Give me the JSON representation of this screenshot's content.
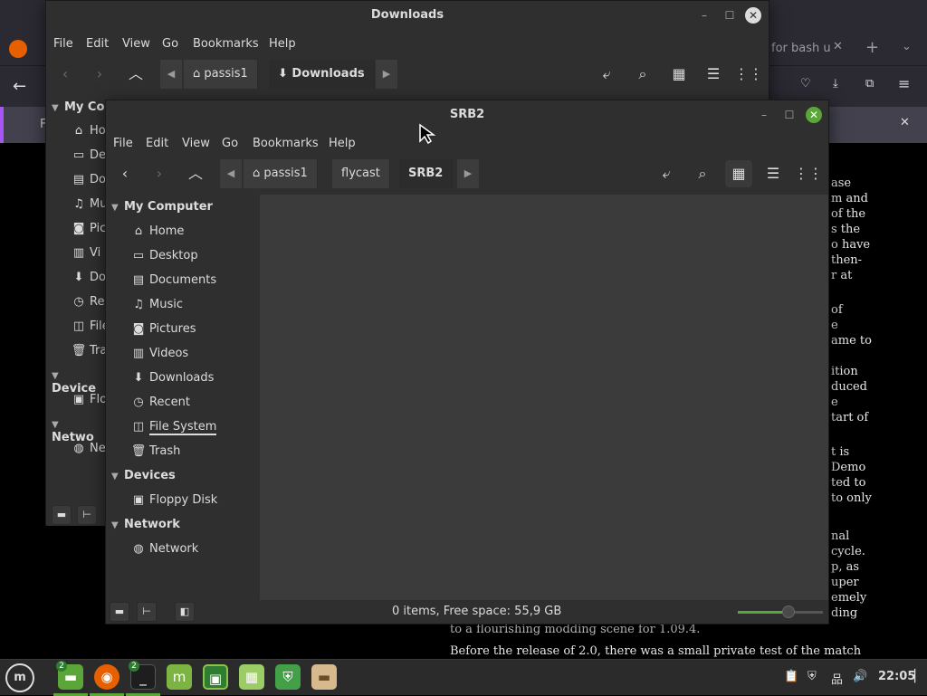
{
  "browser": {
    "tab_fragment": "for bash u",
    "notif_letter": "F",
    "article_right_fragments": [
      "ase",
      "m and",
      "of the",
      "s the",
      "o have",
      "then-",
      "r at",
      "of",
      "e",
      "ame to",
      "ition",
      "duced",
      "e",
      "tart of",
      "t is",
      "Demo",
      "ted to",
      "to only",
      "nal",
      "cycle.",
      "p, as",
      "uper",
      "emely",
      "ding"
    ],
    "article_lines": [
      "to a flourishing modding scene for 1.09.4.",
      "Before the release of 2.0, there was a small private test of the match"
    ]
  },
  "back_window": {
    "title": "Downloads",
    "menu": [
      "File",
      "Edit",
      "View",
      "Go",
      "Bookmarks",
      "Help"
    ],
    "crumbs": [
      "passis1",
      "Downloads"
    ],
    "sidebar_head_computer": "My Co",
    "sidebar_items": [
      "Ho",
      "De",
      "Do",
      "Mu",
      "Pic",
      "Vi",
      "Do",
      "Re",
      "File",
      "Tra"
    ],
    "sidebar_head_devices": "Device",
    "device_item": "Flo",
    "sidebar_head_network": "Netwo",
    "network_item": "Ne"
  },
  "window": {
    "title": "SRB2",
    "menu": {
      "file": "File",
      "edit": "Edit",
      "view": "View",
      "go": "Go",
      "bookmarks": "Bookmarks",
      "help": "Help"
    },
    "crumbs": {
      "home": "passis1",
      "folder": "flycast",
      "current": "SRB2"
    },
    "sidebar": {
      "my_computer": "My Computer",
      "home": "Home",
      "desktop": "Desktop",
      "documents": "Documents",
      "music": "Music",
      "pictures": "Pictures",
      "videos": "Videos",
      "downloads": "Downloads",
      "recent": "Recent",
      "file_system": "File System",
      "trash": "Trash",
      "devices": "Devices",
      "floppy": "Floppy Disk",
      "network_head": "Network",
      "network": "Network"
    },
    "status": "0 items, Free space: 55,9 GB",
    "zoom_level": 0.6
  },
  "taskbar": {
    "badge_files": "2",
    "badge_terminal": "2",
    "clock": "22:05"
  },
  "colors": {
    "accent": "#5aa638",
    "browser_accent": "#a855f7"
  }
}
